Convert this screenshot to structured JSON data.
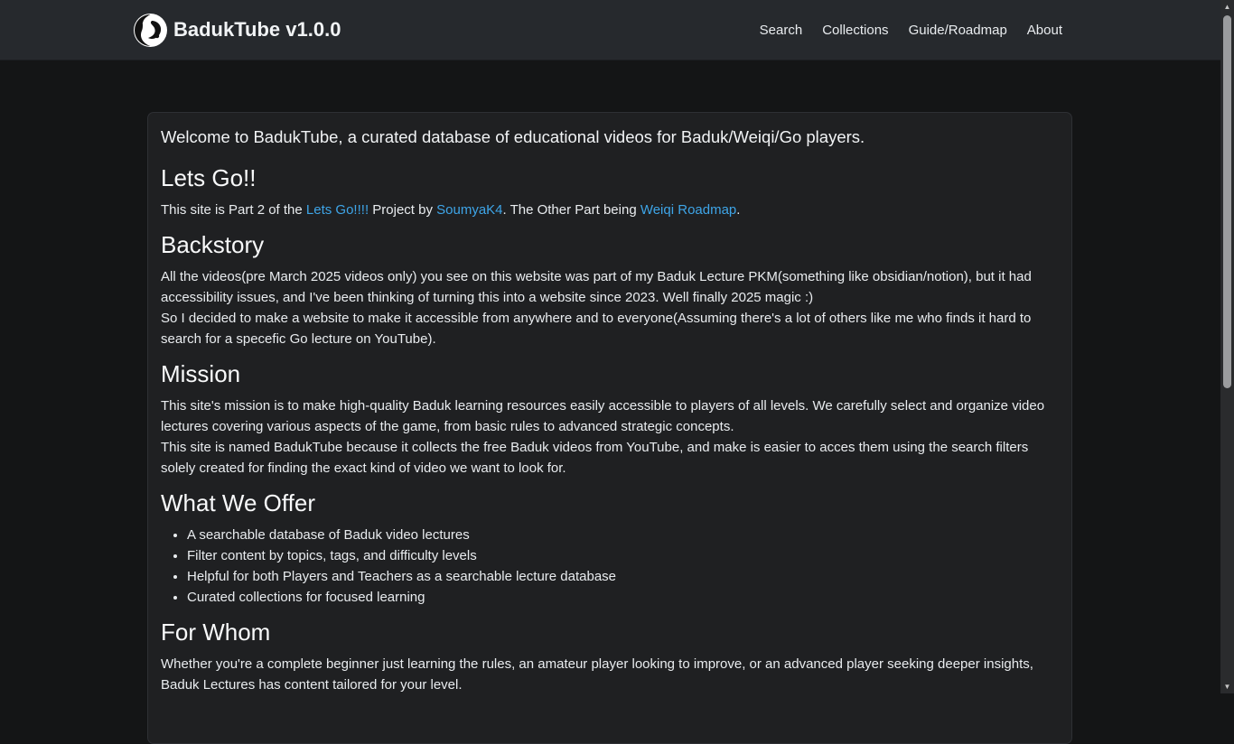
{
  "navbar": {
    "brand": "BadukTube v1.0.0",
    "links": [
      "Search",
      "Collections",
      "Guide/Roadmap",
      "About"
    ]
  },
  "main": {
    "intro": "Welcome to BadukTube, a curated database of educational videos for Baduk/Weiqi/Go players.",
    "sections": {
      "letsgo": {
        "heading": "Lets Go!!",
        "text_1": "This site is Part 2 of the ",
        "link_1": "Lets Go!!!!",
        "text_2": " Project by ",
        "link_2": "SoumyaK4",
        "text_3": ". The Other Part being ",
        "link_3": "Weiqi Roadmap",
        "text_4": "."
      },
      "backstory": {
        "heading": "Backstory",
        "paragraph_1": "All the videos(pre March 2025 videos only) you see on this website was part of my Baduk Lecture PKM(something like obsidian/notion), but it had accessibility issues, and I've been thinking of turning this into a website since 2023. Well finally 2025 magic :)",
        "paragraph_2": "So I decided to make a website to make it accessible from anywhere and to everyone(Assuming there's a lot of others like me who finds it hard to search for a specefic Go lecture on YouTube)."
      },
      "mission": {
        "heading": "Mission",
        "paragraph_1": "This site's mission is to make high-quality Baduk learning resources easily accessible to players of all levels. We carefully select and organize video lectures covering various aspects of the game, from basic rules to advanced strategic concepts.",
        "paragraph_2": "This site is named BadukTube because it collects the free Baduk videos from YouTube, and make is easier to acces them using the search filters solely created for finding the exact kind of video we want to look for."
      },
      "offer": {
        "heading": "What We Offer",
        "items": [
          "A searchable database of Baduk video lectures",
          "Filter content by topics, tags, and difficulty levels",
          "Helpful for both Players and Teachers as a searchable lecture database",
          "Curated collections for focused learning"
        ]
      },
      "whom": {
        "heading": "For Whom",
        "paragraph": "Whether you're a complete beginner just learning the rules, an amateur player looking to improve, or an advanced player seeking deeper insights, Baduk Lectures has content tailored for your level."
      }
    }
  },
  "colors": {
    "navbar_bg": "#26292d",
    "page_bg": "#141516",
    "card_bg": "#1f2022",
    "link": "#3ea5e8"
  },
  "icons": {
    "logo": "go-stone-logo-icon"
  }
}
